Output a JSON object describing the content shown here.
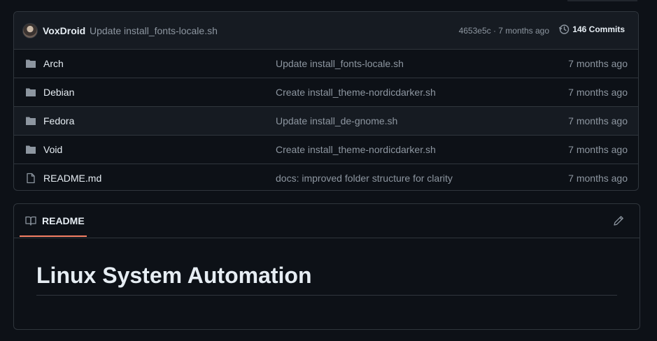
{
  "latest_commit": {
    "author": "VoxDroid",
    "message": "Update install_fonts-locale.sh",
    "meta": "4653e5c · 7 months ago",
    "commits_label": "146 Commits"
  },
  "files": [
    {
      "name": "Arch",
      "type": "folder",
      "message": "Update install_fonts-locale.sh",
      "date": "7 months ago"
    },
    {
      "name": "Debian",
      "type": "folder",
      "message": "Create install_theme-nordicdarker.sh",
      "date": "7 months ago"
    },
    {
      "name": "Fedora",
      "type": "folder",
      "message": "Update install_de-gnome.sh",
      "date": "7 months ago"
    },
    {
      "name": "Void",
      "type": "folder",
      "message": "Create install_theme-nordicdarker.sh",
      "date": "7 months ago"
    },
    {
      "name": "README.md",
      "type": "file",
      "message": "docs: improved folder structure for clarity",
      "date": "7 months ago"
    }
  ],
  "readme": {
    "tab_label": "README",
    "heading": "Linux System Automation"
  },
  "colors": {
    "background": "#0d1117",
    "accent_underline": "#f78166",
    "muted_text": "#8d96a0",
    "border": "#30363d"
  }
}
